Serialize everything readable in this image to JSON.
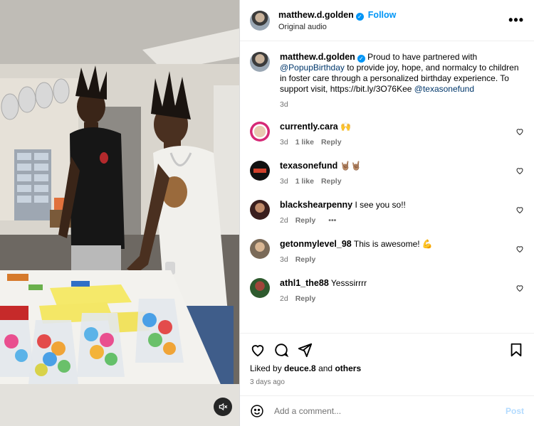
{
  "post": {
    "author": "matthew.d.golden",
    "follow_label": "Follow",
    "audio": "Original audio",
    "more_label": "•••"
  },
  "caption": {
    "author": "matthew.d.golden",
    "text_1": " Proud to have partnered with ",
    "mention_1": "@PopupBirthday",
    "text_2": " to provide joy, hope, and normalcy to children in foster care through a personalized birthday experience. To support visit,  https://bit.ly/3O76Kee ",
    "mention_2": "@texasonefund",
    "time": "3d"
  },
  "comments": [
    {
      "user": "currently.cara",
      "text": "🙌",
      "time": "3d",
      "likes": "1 like",
      "reply": "Reply"
    },
    {
      "user": "texasonefund",
      "text": "🤘🏽🤘🏽",
      "time": "3d",
      "likes": "1 like",
      "reply": "Reply"
    },
    {
      "user": "blackshearpenny",
      "text": "I see you so!!",
      "time": "2d",
      "likes": "",
      "reply": "Reply",
      "extra": "•••"
    },
    {
      "user": "getonmylevel_98",
      "text": "This is awesome! 💪",
      "time": "3d",
      "likes": "",
      "reply": "Reply"
    },
    {
      "user": "athl1_the88",
      "text": "Yesssirrrr",
      "time": "2d",
      "likes": "",
      "reply": "Reply"
    }
  ],
  "likes": {
    "prefix": "Liked by ",
    "user": "deuce.8",
    "mid": " and ",
    "others": "others"
  },
  "posted_ago": "3 days ago",
  "add_comment": {
    "placeholder": "Add a comment...",
    "post_label": "Post"
  },
  "colors": {
    "accent": "#0095f6",
    "muted": "#737373",
    "post_disabled": "#b3dbff"
  },
  "icons": [
    "heart-icon",
    "comment-icon",
    "share-icon",
    "bookmark-icon",
    "emoji-icon",
    "mute-icon",
    "verified-badge-icon"
  ]
}
